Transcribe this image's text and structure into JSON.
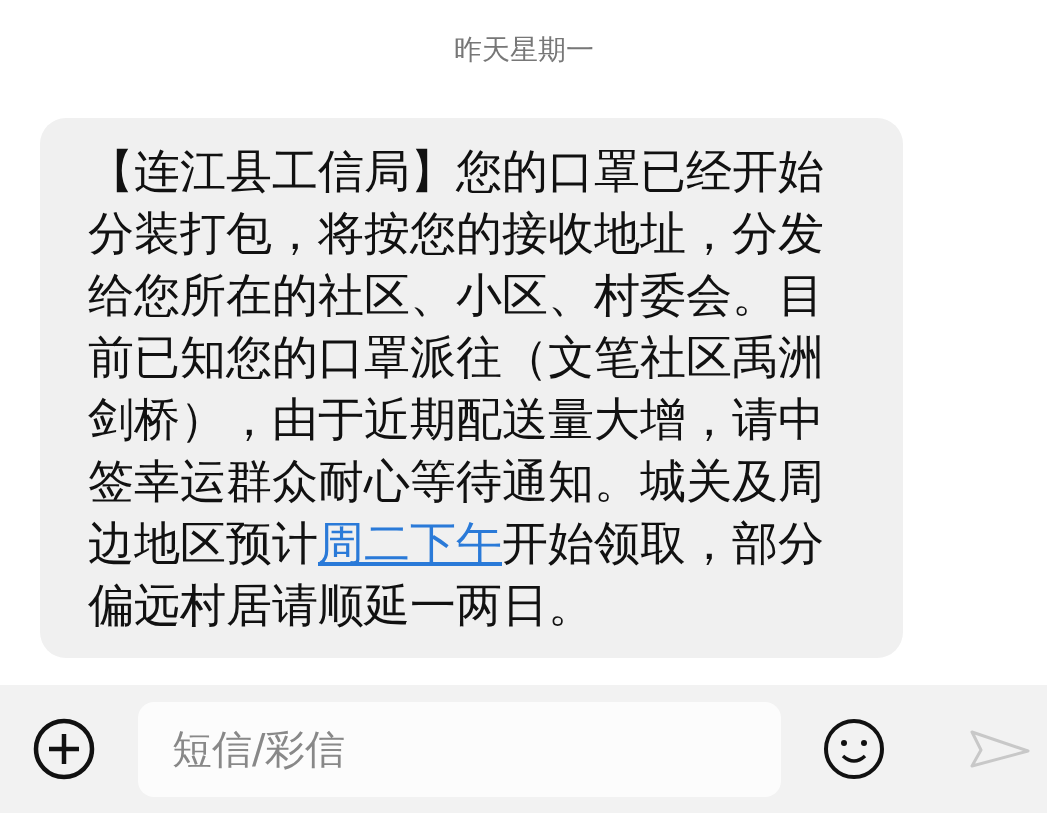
{
  "date_header": "昨天星期一",
  "message": {
    "text_before": "【连江县工信局】您的口罩已经开始分装打包，将按您的接收地址，分发给您所在的社区、小区、村委会。目前已知您的口罩派往（文笔社区禹洲剑桥），由于近期配送量大增，请中签幸运群众耐心等待通知。城关及周边地区预计",
    "link": "周二下午",
    "text_after": "开始领取，部分偏远村居请顺延一两日。"
  },
  "composer": {
    "placeholder": "短信/彩信"
  }
}
